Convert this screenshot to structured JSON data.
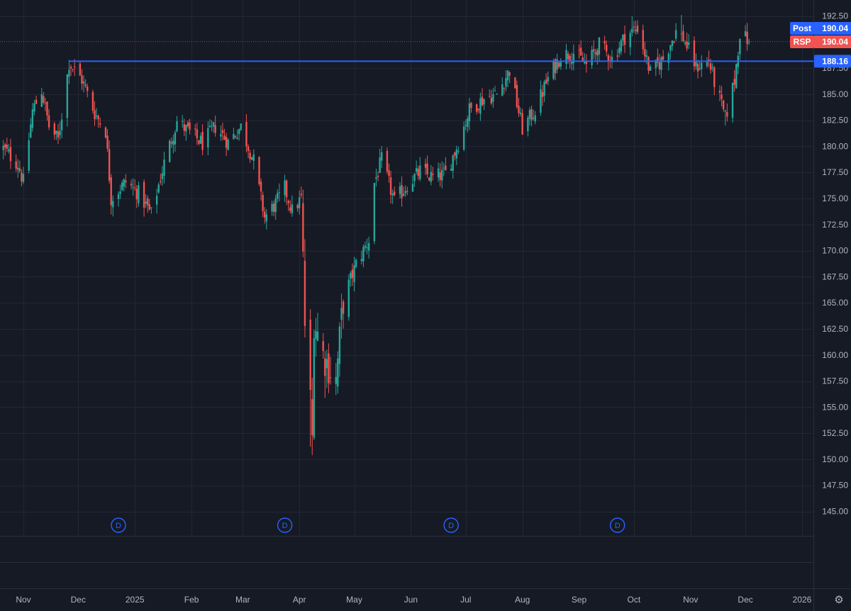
{
  "symbol": "RSP",
  "colors": {
    "background": "#161a25",
    "grid": "#232734",
    "up": "#26a69a",
    "down": "#ef5350",
    "hline": "#2962ff",
    "post_tag": "#2962ff",
    "symbol_tag": "#f05350"
  },
  "icons": {
    "settings": "gear-icon",
    "dividend": "circle-d-icon"
  },
  "settings_glyph": "⚙",
  "chart_data": {
    "type": "candlestick",
    "ylim": [
      143.5,
      193.5
    ],
    "y_ticks": [
      "192.50",
      "187.50",
      "185.00",
      "182.50",
      "180.00",
      "177.50",
      "175.00",
      "172.50",
      "170.00",
      "167.50",
      "165.00",
      "162.50",
      "160.00",
      "157.50",
      "155.00",
      "152.50",
      "150.00",
      "147.50",
      "145.00"
    ],
    "x_labels": [
      {
        "label": "Nov",
        "date": "2024-11-01"
      },
      {
        "label": "Dec",
        "date": "2024-12-01"
      },
      {
        "label": "2025",
        "date": "2025-01-01"
      },
      {
        "label": "Feb",
        "date": "2025-02-01"
      },
      {
        "label": "Mar",
        "date": "2025-03-01"
      },
      {
        "label": "Apr",
        "date": "2025-04-01"
      },
      {
        "label": "May",
        "date": "2025-05-01"
      },
      {
        "label": "Jun",
        "date": "2025-06-01"
      },
      {
        "label": "Jul",
        "date": "2025-07-01"
      },
      {
        "label": "Aug",
        "date": "2025-08-01"
      },
      {
        "label": "Sep",
        "date": "2025-09-01"
      },
      {
        "label": "Oct",
        "date": "2025-10-01"
      },
      {
        "label": "Nov",
        "date": "2025-11-01"
      },
      {
        "label": "Dec",
        "date": "2025-12-01"
      },
      {
        "label": "2026",
        "date": "2026-01-01"
      }
    ],
    "horizontal_line": {
      "value": 188.16,
      "label": "188.16",
      "start_date": "2024-11-26"
    },
    "price_tags": [
      {
        "name": "Post",
        "value": "190.04"
      },
      {
        "name": "RSP",
        "value": "190.04"
      }
    ],
    "dividend_markers": [
      {
        "date": "2024-12-23",
        "label": "D"
      },
      {
        "date": "2025-03-24",
        "label": "D"
      },
      {
        "date": "2025-06-23",
        "label": "D"
      },
      {
        "date": "2025-09-22",
        "label": "D"
      }
    ],
    "anchors": [
      [
        "2024-10-21",
        179.8
      ],
      [
        "2024-10-29",
        178.3
      ],
      [
        "2024-11-01",
        176.6
      ],
      [
        "2024-11-06",
        183.4
      ],
      [
        "2024-11-11",
        185.4
      ],
      [
        "2024-11-15",
        181.9
      ],
      [
        "2024-11-20",
        180.6
      ],
      [
        "2024-11-26",
        188.0
      ],
      [
        "2024-12-03",
        186.4
      ],
      [
        "2024-12-10",
        183.2
      ],
      [
        "2024-12-16",
        181.5
      ],
      [
        "2024-12-19",
        175.0
      ],
      [
        "2024-12-27",
        176.6
      ],
      [
        "2025-01-03",
        175.5
      ],
      [
        "2025-01-10",
        173.5
      ],
      [
        "2025-01-17",
        178.4
      ],
      [
        "2025-01-24",
        182.4
      ],
      [
        "2025-01-31",
        181.3
      ],
      [
        "2025-02-07",
        180.3
      ],
      [
        "2025-02-14",
        181.9
      ],
      [
        "2025-02-21",
        180.4
      ],
      [
        "2025-02-28",
        181.9
      ],
      [
        "2025-03-07",
        178.6
      ],
      [
        "2025-03-13",
        173.2
      ],
      [
        "2025-03-19",
        174.5
      ],
      [
        "2025-03-24",
        176.0
      ],
      [
        "2025-03-28",
        173.8
      ],
      [
        "2025-04-02",
        175.0
      ],
      [
        "2025-04-04",
        163.0
      ],
      [
        "2025-04-07",
        155.5
      ],
      [
        "2025-04-08",
        152.0
      ],
      [
        "2025-04-09",
        163.5
      ],
      [
        "2025-04-14",
        160.0
      ],
      [
        "2025-04-21",
        157.5
      ],
      [
        "2025-04-25",
        165.3
      ],
      [
        "2025-05-02",
        168.7
      ],
      [
        "2025-05-09",
        171.0
      ],
      [
        "2025-05-12",
        176.5
      ],
      [
        "2025-05-16",
        178.7
      ],
      [
        "2025-05-23",
        174.7
      ],
      [
        "2025-05-30",
        176.3
      ],
      [
        "2025-06-06",
        177.6
      ],
      [
        "2025-06-13",
        177.0
      ],
      [
        "2025-06-20",
        177.4
      ],
      [
        "2025-06-27",
        180.3
      ],
      [
        "2025-07-03",
        183.5
      ],
      [
        "2025-07-11",
        184.6
      ],
      [
        "2025-07-18",
        185.0
      ],
      [
        "2025-07-25",
        187.3
      ],
      [
        "2025-08-01",
        181.7
      ],
      [
        "2025-08-08",
        183.5
      ],
      [
        "2025-08-15",
        186.5
      ],
      [
        "2025-08-22",
        188.7
      ],
      [
        "2025-08-29",
        189.0
      ],
      [
        "2025-09-05",
        187.8
      ],
      [
        "2025-09-12",
        189.7
      ],
      [
        "2025-09-19",
        188.4
      ],
      [
        "2025-09-26",
        190.5
      ],
      [
        "2025-10-03",
        191.4
      ],
      [
        "2025-10-10",
        187.0
      ],
      [
        "2025-10-17",
        188.4
      ],
      [
        "2025-10-24",
        191.0
      ],
      [
        "2025-10-28",
        190.4
      ],
      [
        "2025-11-04",
        187.6
      ],
      [
        "2025-11-11",
        188.2
      ],
      [
        "2025-11-14",
        186.2
      ],
      [
        "2025-11-20",
        182.7
      ],
      [
        "2025-11-25",
        186.3
      ],
      [
        "2025-11-28",
        190.9
      ],
      [
        "2025-12-03",
        190.04
      ]
    ]
  }
}
